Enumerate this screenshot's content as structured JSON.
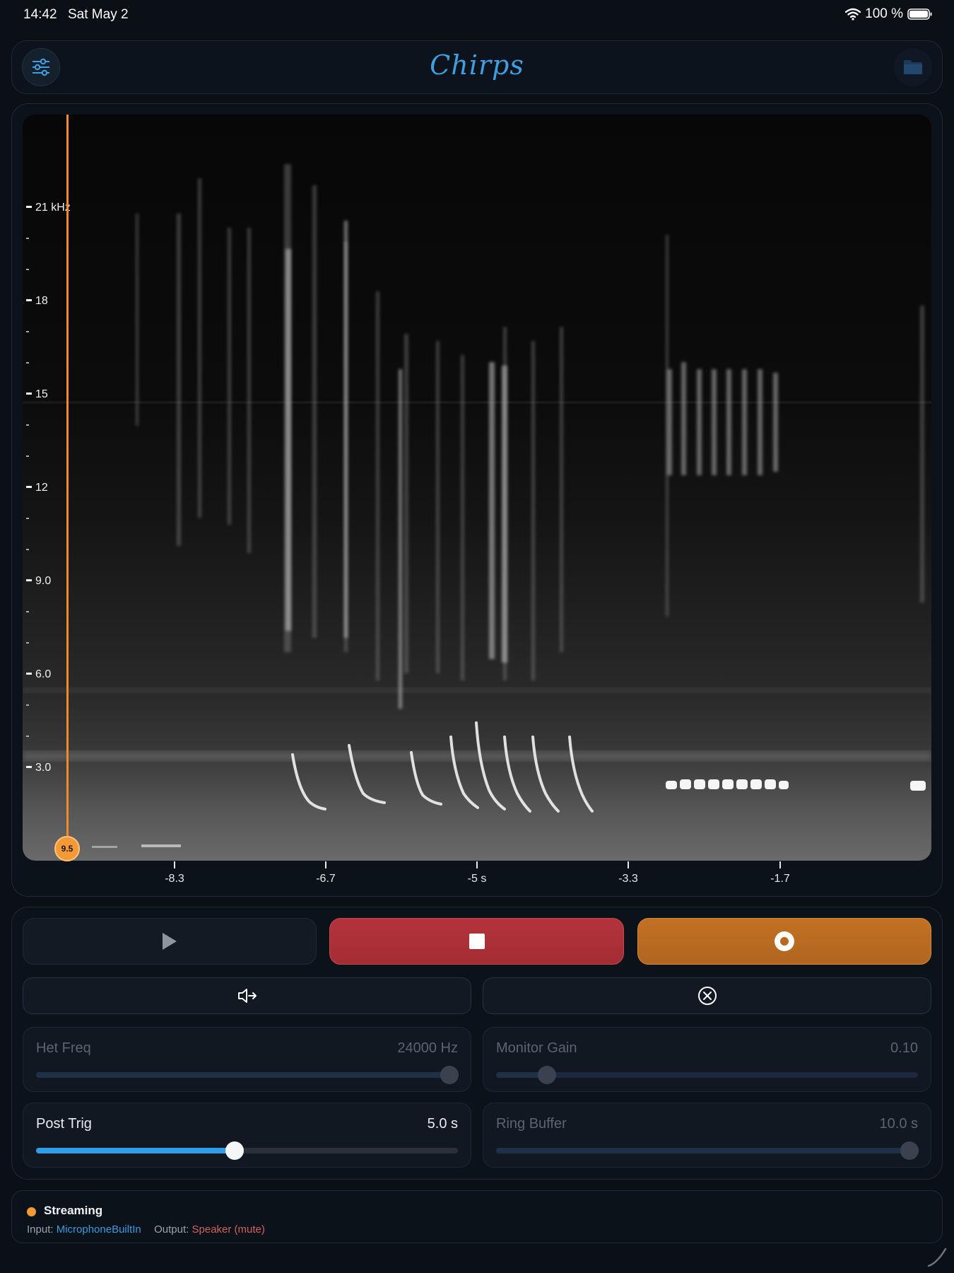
{
  "status_bar": {
    "time": "14:42",
    "date": "Sat May 2",
    "battery": "100 %",
    "icons": [
      "wifi-icon",
      "battery-icon"
    ]
  },
  "header": {
    "title": "Chirps",
    "left_icon": "sliders-icon",
    "right_icon": "folder-icon",
    "accent_color": "#3f9fe0"
  },
  "spectrogram": {
    "y_axis": {
      "unit": "kHz",
      "labels": [
        "21 kHz",
        "18",
        "15",
        "12",
        "9.0",
        "6.0",
        "3.0"
      ]
    },
    "x_axis": {
      "labels": [
        "-8.3",
        "-6.7",
        "-5 s",
        "-3.3",
        "-1.7"
      ]
    },
    "cursor": {
      "value": "9.5",
      "color": "#f08a2e"
    }
  },
  "transport": {
    "play_icon": "play-icon",
    "stop_icon": "stop-icon",
    "record_icon": "record-icon",
    "stop_color": "#b3333b",
    "record_color": "#c27124",
    "monitor_icon": "speaker-output-icon",
    "clear_icon": "clear-x-icon"
  },
  "sliders": {
    "het_freq": {
      "label": "Het Freq",
      "value": "24000 Hz",
      "level": 0.98,
      "enabled": false
    },
    "monitor_gain": {
      "label": "Monitor Gain",
      "value": "0.10",
      "level": 0.12,
      "enabled": false
    },
    "post_trig": {
      "label": "Post Trig",
      "value": "5.0 s",
      "level": 0.47,
      "enabled": true
    },
    "ring_buffer": {
      "label": "Ring Buffer",
      "value": "10.0 s",
      "level": 0.98,
      "enabled": false
    }
  },
  "footer": {
    "state": "Streaming",
    "state_color": "#f39a36",
    "input_label": "Input:",
    "input_value": "MicrophoneBuiltIn",
    "output_label": "Output:",
    "output_value": "Speaker (mute)"
  }
}
